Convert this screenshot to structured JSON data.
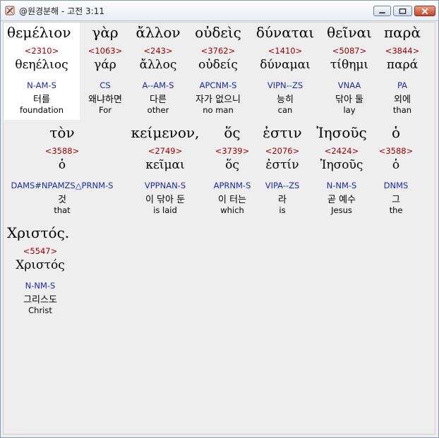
{
  "window": {
    "title": "@원경분해 - 고전 3:11",
    "buttons": {
      "minimize": "minimize-icon",
      "maximize": "maximize-icon",
      "close": "close-icon"
    },
    "accent": "#c4452b"
  },
  "colors": {
    "strongs": "#a00000",
    "parsing": "#1a2ca0",
    "text": "#000000"
  },
  "words": [
    {
      "greek": "θεμέλιον",
      "strongs": "<2310>",
      "lemma": "θεηέλιος",
      "parsing": "N-AM-S",
      "korean": "터를",
      "english": "foundation",
      "selected": true
    },
    {
      "greek": "γὰρ",
      "strongs": "<1063>",
      "lemma": "γάρ",
      "parsing": "CS",
      "korean": "왜냐하면",
      "english": "For"
    },
    {
      "greek": "ἄλλον",
      "strongs": "<243>",
      "lemma": "ἄλλος",
      "parsing": "A--AM-S",
      "korean": "다른",
      "english": "other"
    },
    {
      "greek": "οὐδεὶς",
      "strongs": "<3762>",
      "lemma": "οὐδείς",
      "parsing": "APCNM-S",
      "korean": "자가 없으니",
      "english": "no man"
    },
    {
      "greek": "δύναται",
      "strongs": "<1410>",
      "lemma": "δύναμαι",
      "parsing": "VIPN--ZS",
      "korean": "능히",
      "english": "can"
    },
    {
      "greek": "θεῖναι",
      "strongs": "<5087>",
      "lemma": "τίθημι",
      "parsing": "VNAA",
      "korean": "닦아 둘",
      "english": "lay"
    },
    {
      "greek": "παρὰ",
      "strongs": "<3844>",
      "lemma": "παρά",
      "parsing": "PA",
      "korean": "외에",
      "english": "than"
    },
    {
      "greek": "τὸν",
      "strongs": "<3588>",
      "lemma": "ὁ",
      "parsing": "DAMS#NPAMZS△PRNM-S",
      "korean": "것",
      "english": "that"
    },
    {
      "greek": "κείμενον,",
      "strongs": "<2749>",
      "lemma": "κεῖμαι",
      "parsing": "VPPNAN-S",
      "korean": "이 닦아 둔",
      "english": "is laid"
    },
    {
      "greek": "ὅς",
      "strongs": "<3739>",
      "lemma": "ὅς",
      "parsing": "APRNM-S",
      "korean": "이 터는",
      "english": "which"
    },
    {
      "greek": "ἐστιν",
      "strongs": "<2076>",
      "lemma": "ἐστίν",
      "parsing": "VIPA--ZS",
      "korean": "라",
      "english": "is"
    },
    {
      "greek": "Ἰησοῦς",
      "strongs": "<2424>",
      "lemma": "Ἰησοῦς",
      "parsing": "N-NM-S",
      "korean": "곧 예수",
      "english": "Jesus"
    },
    {
      "greek": "ὁ",
      "strongs": "<3588>",
      "lemma": "ὁ",
      "parsing": "DNMS",
      "korean": "그",
      "english": "the"
    },
    {
      "greek": "Χριστός.",
      "strongs": "<5547>",
      "lemma": "Χριστός",
      "parsing": "N-NM-S",
      "korean": "그리스도",
      "english": "Christ"
    }
  ]
}
